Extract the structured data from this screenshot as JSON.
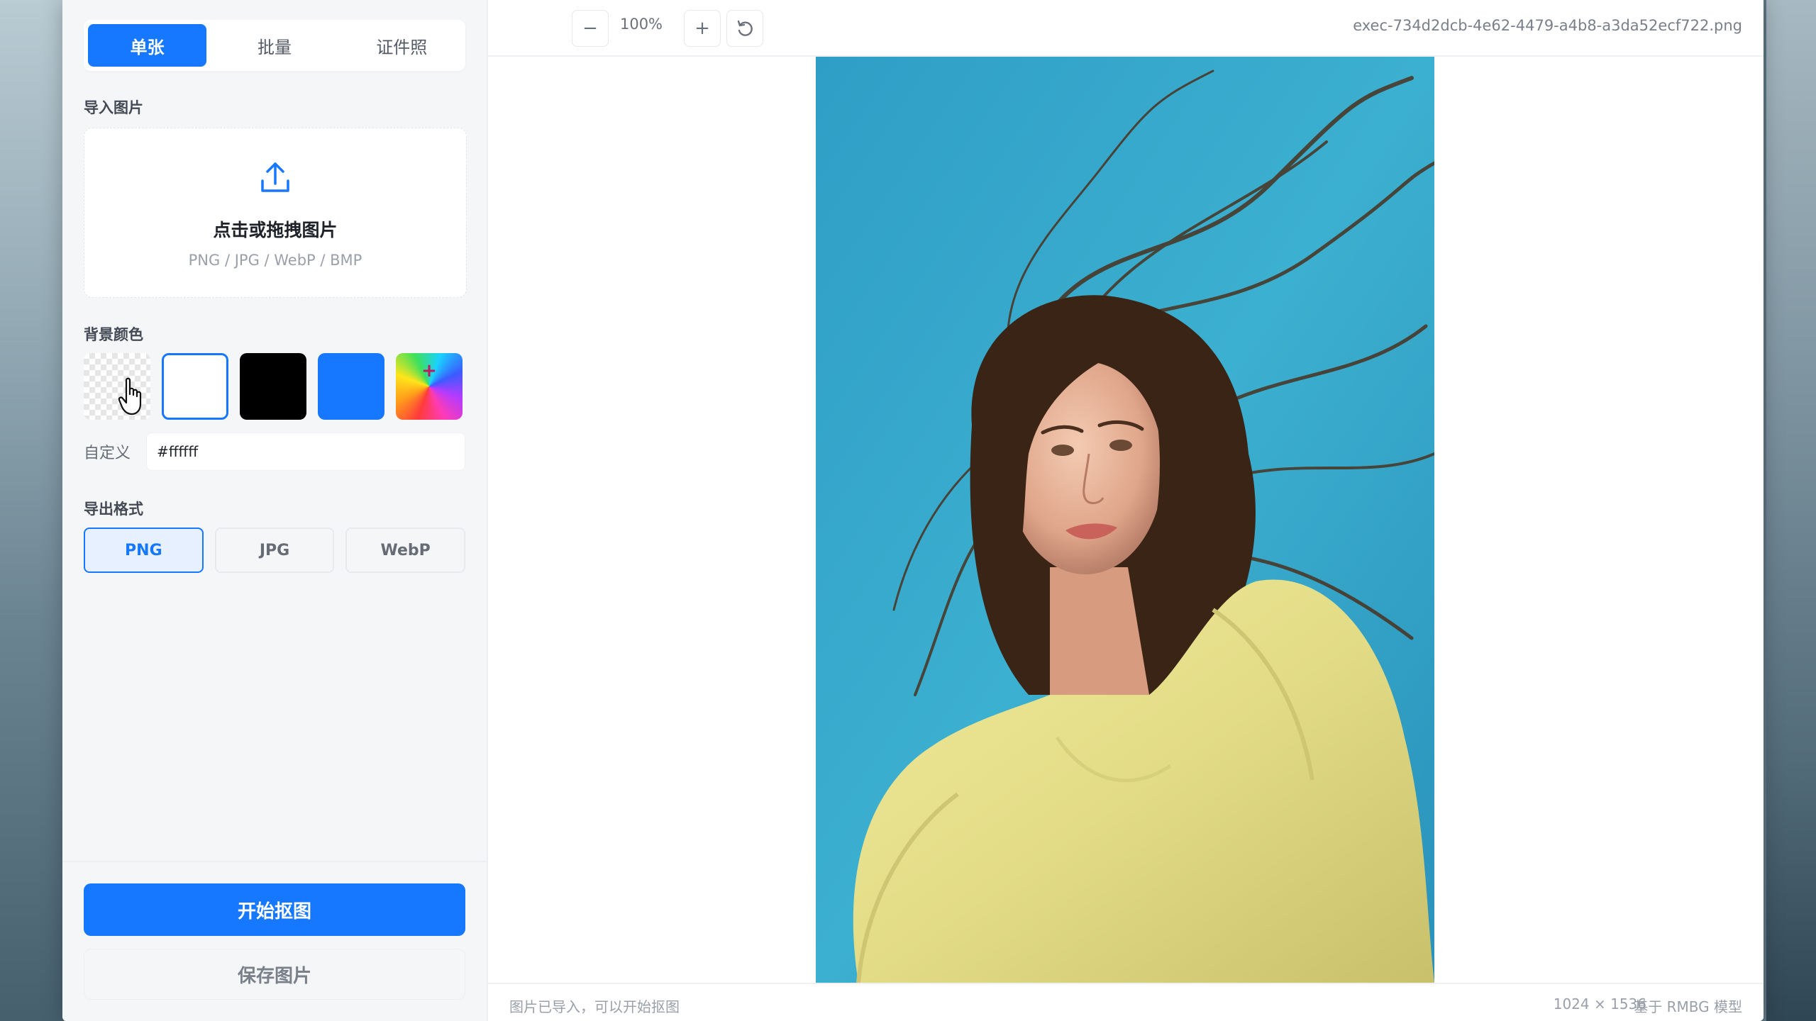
{
  "sidebar": {
    "tabs": [
      {
        "label": "单张",
        "active": true
      },
      {
        "label": "批量",
        "active": false
      },
      {
        "label": "证件照",
        "active": false
      }
    ],
    "import": {
      "section_label": "导入图片",
      "title": "点击或拖拽图片",
      "formats_hint": "PNG / JPG / WebP / BMP",
      "icon": "upload-icon"
    },
    "background": {
      "section_label": "背景颜色",
      "swatches": [
        {
          "name": "transparent"
        },
        {
          "name": "white",
          "color": "#ffffff",
          "selected": true
        },
        {
          "name": "black",
          "color": "#000000"
        },
        {
          "name": "blue",
          "color": "#1677ff"
        },
        {
          "name": "custom-rainbow",
          "symbol": "+"
        }
      ],
      "custom_label": "自定义",
      "custom_value": "#ffffff"
    },
    "export": {
      "section_label": "导出格式",
      "formats": [
        {
          "label": "PNG",
          "active": true
        },
        {
          "label": "JPG",
          "active": false
        },
        {
          "label": "WebP",
          "active": false
        }
      ]
    },
    "start_button": "开始抠图",
    "save_button": "保存图片"
  },
  "toolbar": {
    "zoom_out_symbol": "−",
    "zoom_level": "100%",
    "zoom_in_symbol": "+",
    "reset_icon": "rotate-ccw-icon",
    "filename": "exec-734d2dcb-4e62-4479-a4b8-a3da52ecf722.png"
  },
  "status": {
    "message": "图片已导入，可以开始抠图",
    "dimensions": "1024 × 1536",
    "model": "基于 RMBG 模型"
  },
  "colors": {
    "accent": "#1677ff",
    "sidebar_bg": "#f5f6f8",
    "photo_sky": "#3aa6c8",
    "dress": "#e6e08a"
  }
}
